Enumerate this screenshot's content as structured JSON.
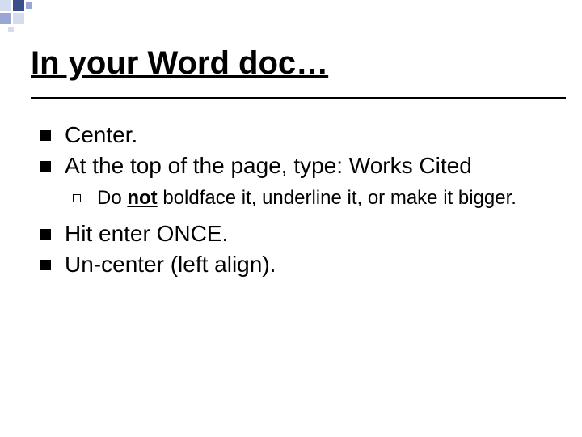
{
  "title": "In your Word doc…",
  "bullets": {
    "b1": "Center.",
    "b2": "At the top of the page, type: Works Cited",
    "sub_pre": "Do ",
    "sub_not": "not",
    "sub_post": " boldface it, underline it, or make it bigger.",
    "b3": "Hit enter ONCE.",
    "b4": "Un-center (left align)."
  },
  "colors": {
    "accent_dark": "#3b4e8c",
    "accent_mid": "#9aa7d4",
    "accent_light": "#d4dcef"
  }
}
